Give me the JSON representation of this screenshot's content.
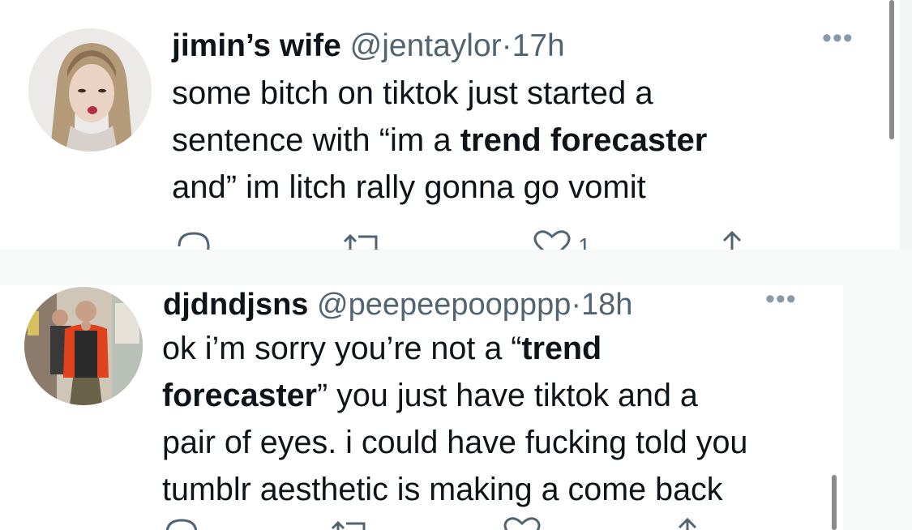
{
  "tweets": [
    {
      "display_name": "jimin’s wife",
      "handle": "@jentaylor",
      "separator": "·",
      "time": "17h",
      "more_icon": "•••",
      "body_lines": [
        [
          "some bitch on tiktok just started a"
        ],
        [
          "sentence with “im a ",
          "trend forecaster"
        ],
        [
          "and” im litch rally gonna go vomit"
        ]
      ],
      "likes": "1"
    },
    {
      "display_name": "djdndjsns",
      "handle": "@peepeepoopppp",
      "separator": "·",
      "time": "18h",
      "more_icon": "•••",
      "body_lines": [
        [
          "ok i’m sorry you’re not a “",
          "trend"
        ],
        [
          "forecaster",
          "” you just have tiktok and a"
        ],
        [
          "pair of eyes. i could have fucking told you"
        ],
        [
          "tumblr aesthetic is making a come back"
        ]
      ]
    }
  ],
  "icons": [
    "reply-icon",
    "retweet-icon",
    "like-icon",
    "share-icon",
    "more-icon"
  ]
}
